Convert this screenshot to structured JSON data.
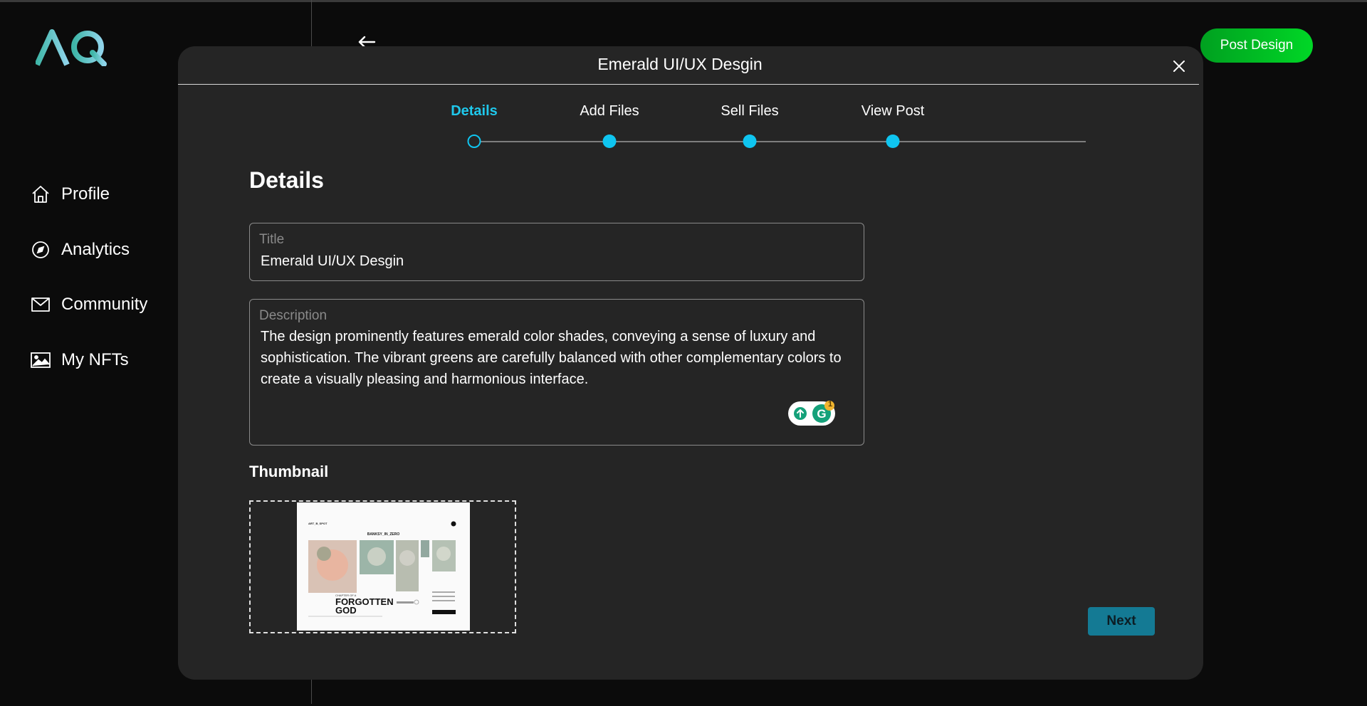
{
  "app": {
    "logo_text": "AQ"
  },
  "sidebar": {
    "items": [
      {
        "label": "Profile",
        "icon": "home-icon"
      },
      {
        "label": "Analytics",
        "icon": "compass-icon"
      },
      {
        "label": "Community",
        "icon": "mail-icon"
      },
      {
        "label": "My NFTs",
        "icon": "image-icon"
      }
    ]
  },
  "header": {
    "post_design_label": "Post Design"
  },
  "modal": {
    "title": "Emerald UI/UX Desgin",
    "steps": [
      {
        "label": "Details",
        "state": "current"
      },
      {
        "label": "Add Files",
        "state": "pending"
      },
      {
        "label": "Sell Files",
        "state": "pending"
      },
      {
        "label": "View Post",
        "state": "pending"
      }
    ],
    "section_title": "Details",
    "title_field": {
      "label": "Title",
      "value": "Emerald UI/UX Desgin"
    },
    "description_field": {
      "label": "Description",
      "value": "The design prominently features emerald color shades, conveying a sense of luxury and sophistication. The vibrant greens are carefully balanced with other complementary colors to create a visually pleasing and harmonious interface."
    },
    "grammarly_badge_count": "1",
    "thumbnail": {
      "label": "Thumbnail",
      "preview": {
        "top_left": "ART_B_SPOT",
        "header": "BANKSY_IN_ZERO",
        "headline_line1": "FORGOTTEN",
        "headline_line2": "GOD",
        "kicker": "CHAPTER OF A"
      }
    },
    "next_label": "Next"
  },
  "colors": {
    "accent": "#0fc5f0",
    "post_button": "#00c020",
    "next_button": "#147a94",
    "modal_bg": "#252525",
    "page_bg": "#0b0b0b"
  }
}
